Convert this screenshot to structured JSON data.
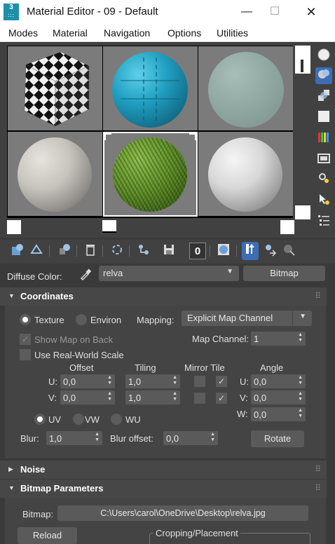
{
  "window": {
    "app_icon_text": "3",
    "title": "Material Editor - 09 - Default",
    "minimize": "—",
    "maximize": "☐",
    "close": "✕"
  },
  "menu": {
    "items": [
      "Modes",
      "Material",
      "Navigation",
      "Options",
      "Utilities"
    ]
  },
  "diffuse": {
    "label": "Diffuse Color:",
    "map_name": "relva",
    "map_type": "Bitmap"
  },
  "coordinates": {
    "title": "Coordinates",
    "texture_label": "Texture",
    "environ_label": "Environ",
    "mapping_label": "Mapping:",
    "mapping_value": "Explicit Map Channel",
    "show_map_on_back": "Show Map on Back",
    "map_channel_label": "Map Channel:",
    "map_channel_value": "1",
    "use_real_world": "Use Real-World Scale",
    "offset_header": "Offset",
    "tiling_header": "Tiling",
    "mirror_tile_header": "Mirror Tile",
    "angle_header": "Angle",
    "u_label": "U:",
    "v_label": "V:",
    "w_label": "W:",
    "offset_u": "0,0",
    "offset_v": "0,0",
    "tiling_u": "1,0",
    "tiling_v": "1,0",
    "angle_u": "0,0",
    "angle_v": "0,0",
    "angle_w": "0,0",
    "uv_label": "UV",
    "vw_label": "VW",
    "wu_label": "WU",
    "blur_label": "Blur:",
    "blur_value": "1,0",
    "blur_offset_label": "Blur offset:",
    "blur_offset_value": "0,0",
    "rotate": "Rotate"
  },
  "noise": {
    "title": "Noise"
  },
  "bitmap_params": {
    "title": "Bitmap Parameters",
    "bitmap_label": "Bitmap:",
    "bitmap_path": "C:\\Users\\carol\\OneDrive\\Desktop\\relva.jpg",
    "reload": "Reload",
    "cropping_label": "Cropping/Placement"
  },
  "toolbar_icons": [
    "get-material-icon",
    "put-to-scene-icon",
    "assign-material-icon",
    "delete-icon",
    "make-unique-icon",
    "put-to-library-icon",
    "save-icon",
    "material-id-icon",
    "show-map-icon",
    "show-end-result-icon",
    "go-to-parent-icon",
    "go-forward-icon"
  ],
  "side_icons": [
    "sample-type-icon",
    "backlight-icon",
    "background-icon",
    "uv-tiling-icon",
    "video-color-check-icon",
    "make-preview-icon",
    "options-icon",
    "select-by-material-icon",
    "material-navigator-icon"
  ],
  "colors": {
    "accent": "#3f6db4",
    "panel_bg": "#444444",
    "app_bg": "#3a3a3a"
  }
}
